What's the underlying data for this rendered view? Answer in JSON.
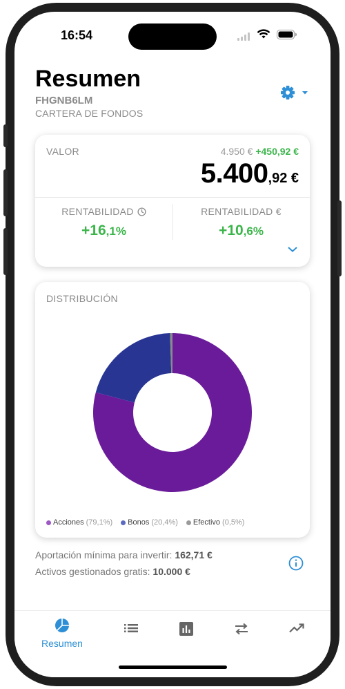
{
  "status": {
    "time": "16:54"
  },
  "header": {
    "title": "Resumen",
    "code": "FHGNB6LM",
    "subtitle": "CARTERA DE FONDOS"
  },
  "valor": {
    "label": "VALOR",
    "previous": "4.950 €",
    "gain": "+450,92 €",
    "amount_int": "5.400",
    "amount_dec": ",92 €",
    "rent_time_label": "RENTABILIDAD",
    "rent_time_int": "+16",
    "rent_time_dec": ",1%",
    "rent_money_label": "RENTABILIDAD €",
    "rent_money_int": "+10",
    "rent_money_dec": ",6%"
  },
  "distribution": {
    "label": "DISTRIBUCIÓN",
    "legend": [
      {
        "name": "Acciones",
        "pct": "(79,1%)",
        "color": "#6a1b9a"
      },
      {
        "name": "Bonos",
        "pct": "(20,4%)",
        "color": "#283593"
      },
      {
        "name": "Efectivo",
        "pct": "(0,5%)",
        "color": "#8a8a8a"
      }
    ]
  },
  "chart_data": {
    "type": "pie",
    "donut": true,
    "categories": [
      "Acciones",
      "Bonos",
      "Efectivo"
    ],
    "values": [
      79.1,
      20.4,
      0.5
    ],
    "colors": [
      "#6a1b9a",
      "#283593",
      "#8a8a8a"
    ]
  },
  "footer": {
    "min_label": "Aportación mínima para invertir:",
    "min_value": "162,71 €",
    "assets_label": "Activos gestionados gratis:",
    "assets_value": "10.000 €"
  },
  "tabs": {
    "resumen": "Resumen"
  },
  "colors": {
    "accent": "#2d8fd5",
    "positive": "#3bb54a"
  }
}
